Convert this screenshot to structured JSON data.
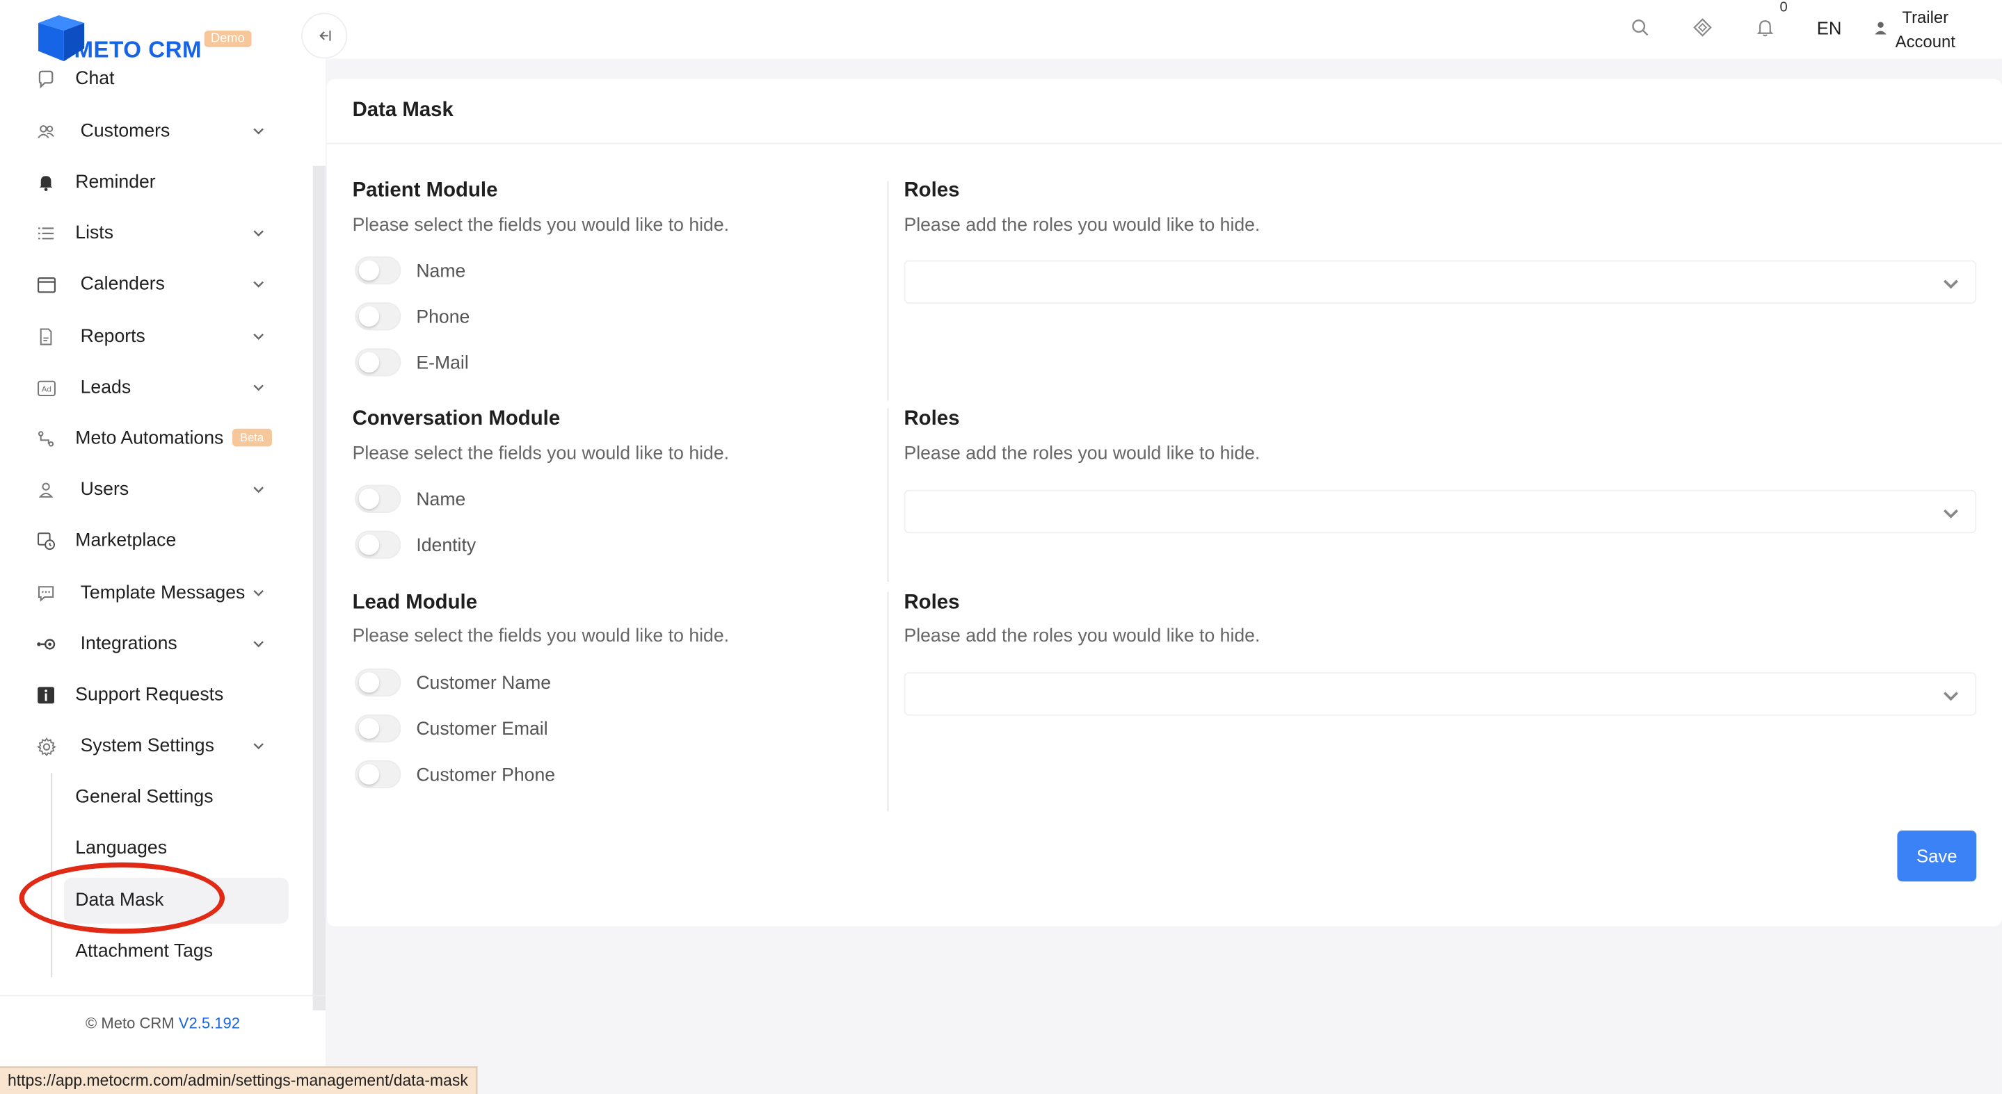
{
  "brand": {
    "name": "METO CRM",
    "badge": "Demo"
  },
  "sidebar": {
    "items": [
      {
        "label": "Chat",
        "icon": "chat-icon"
      },
      {
        "label": "Customers",
        "icon": "customers-icon"
      },
      {
        "label": "Reminder",
        "icon": "bell-icon"
      },
      {
        "label": "Lists",
        "icon": "list-icon"
      },
      {
        "label": "Calenders",
        "icon": "calendar-icon"
      },
      {
        "label": "Reports",
        "icon": "report-icon"
      },
      {
        "label": "Leads",
        "icon": "ad-icon"
      },
      {
        "label": "Meto Automations",
        "icon": "automation-icon",
        "badge": "Beta"
      },
      {
        "label": "Users",
        "icon": "user-icon"
      },
      {
        "label": "Marketplace",
        "icon": "marketplace-icon"
      },
      {
        "label": "Template Messages",
        "icon": "template-icon"
      },
      {
        "label": "Integrations",
        "icon": "integrations-icon"
      },
      {
        "label": "Support Requests",
        "icon": "info-icon"
      },
      {
        "label": "System Settings",
        "icon": "gear-icon"
      }
    ],
    "sub_items": [
      {
        "label": "General Settings"
      },
      {
        "label": "Languages"
      },
      {
        "label": "Data Mask",
        "active": true
      },
      {
        "label": "Attachment Tags"
      }
    ],
    "footer": {
      "copyright": "© Meto CRM",
      "version": "V2.5.192"
    }
  },
  "status_bar": {
    "url": "https://app.metocrm.com/admin/settings-management/data-mask"
  },
  "header": {
    "notification_count": "0",
    "language": "EN",
    "account_line1": "Trailer",
    "account_line2": "Account"
  },
  "page": {
    "title": "Data Mask",
    "modules": [
      {
        "title": "Patient Module",
        "desc": "Please select the fields you would like to hide.",
        "fields": [
          "Name",
          "Phone",
          "E-Mail"
        ],
        "roles_title": "Roles",
        "roles_desc": "Please add the roles you would like to hide."
      },
      {
        "title": "Conversation Module",
        "desc": "Please select the fields you would like to hide.",
        "fields": [
          "Name",
          "Identity"
        ],
        "roles_title": "Roles",
        "roles_desc": "Please add the roles you would like to hide."
      },
      {
        "title": "Lead Module",
        "desc": "Please select the fields you would like to hide.",
        "fields": [
          "Customer Name",
          "Customer Email",
          "Customer Phone"
        ],
        "roles_title": "Roles",
        "roles_desc": "Please add the roles you would like to hide."
      }
    ],
    "save_label": "Save"
  },
  "colors": {
    "primary": "#3b82f6",
    "brand": "#1565e6",
    "badge": "#f6c79a",
    "annotation": "#e02a16"
  }
}
